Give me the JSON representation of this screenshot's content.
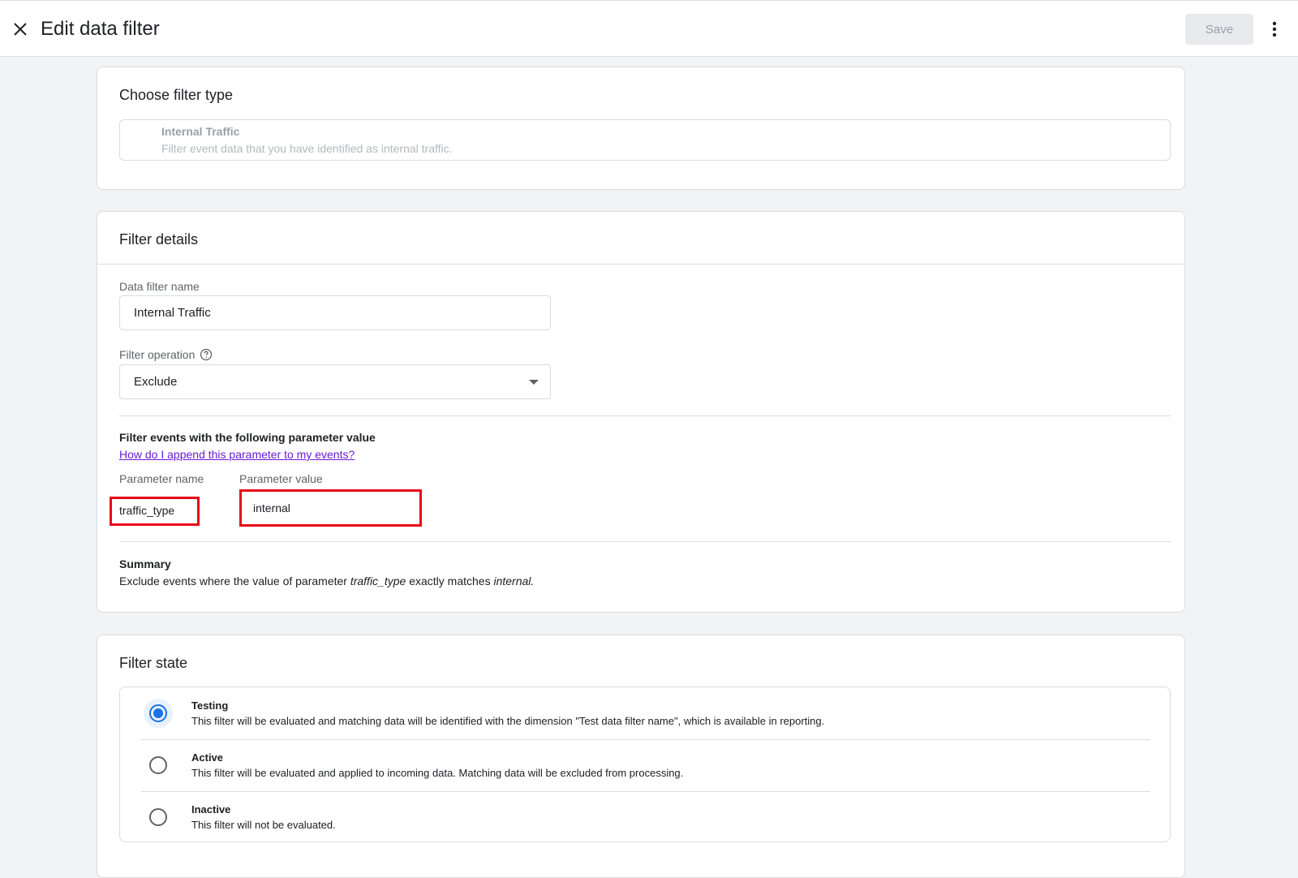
{
  "header": {
    "title": "Edit data filter",
    "save_label": "Save"
  },
  "filter_type": {
    "heading": "Choose filter type",
    "option_title": "Internal Traffic",
    "option_desc": "Filter event data that you have identified as internal traffic."
  },
  "filter_details": {
    "heading": "Filter details",
    "name_label": "Data filter name",
    "name_value": "Internal Traffic",
    "operation_label": "Filter operation",
    "operation_value": "Exclude",
    "param_heading": "Filter events with the following parameter value",
    "param_link": "How do I append this parameter to my events?",
    "param_name_label": "Parameter name",
    "param_name_value": "traffic_type",
    "param_value_label": "Parameter value",
    "param_value_value": "internal",
    "summary_heading": "Summary",
    "summary_prefix": "Exclude events where the value of parameter",
    "summary_param": "traffic_type",
    "summary_middle": "exactly matches",
    "summary_value": "internal."
  },
  "filter_state": {
    "heading": "Filter state",
    "options": [
      {
        "title": "Testing",
        "desc": "This filter will be evaluated and matching data will be identified with the dimension \"Test data filter name\", which is available in reporting.",
        "selected": true
      },
      {
        "title": "Active",
        "desc": "This filter will be evaluated and applied to incoming data. Matching data will be excluded from processing.",
        "selected": false
      },
      {
        "title": "Inactive",
        "desc": "This filter will not be evaluated.",
        "selected": false
      }
    ]
  },
  "colors": {
    "accent": "#1a73e8",
    "highlight": "#e8071a",
    "link": "#6a1bd4"
  },
  "icons": [
    "close-icon",
    "more-vert-icon",
    "help-icon",
    "dropdown-arrow-icon"
  ]
}
